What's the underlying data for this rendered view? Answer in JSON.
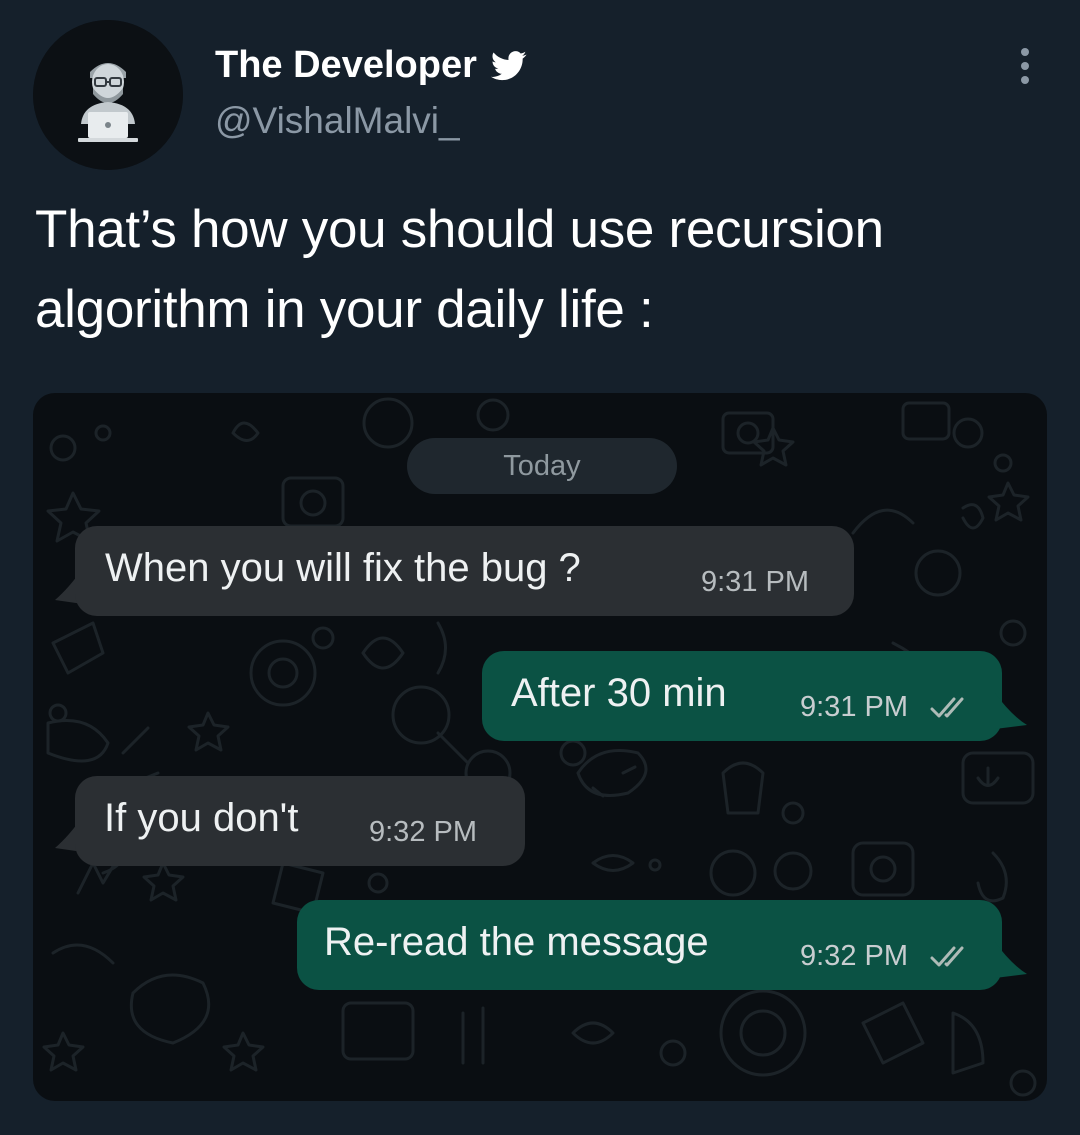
{
  "tweet": {
    "display_name": "The Developer",
    "handle": "@VishalMalvi_",
    "text": "That’s how you should use recursion algorithm in your daily life :",
    "icons": {
      "verified": "twitter-bird-icon",
      "more": "more-vertical-icon",
      "avatar": "developer-avatar-icon"
    }
  },
  "chat": {
    "date_label": "Today",
    "messages": [
      {
        "direction": "incoming",
        "text": "When you will fix the bug ?",
        "time": "9:31 PM"
      },
      {
        "direction": "outgoing",
        "text": "After 30 min",
        "time": "9:31 PM",
        "status": "read"
      },
      {
        "direction": "incoming",
        "text": "If you don't",
        "time": "9:32 PM"
      },
      {
        "direction": "outgoing",
        "text": "Re-read the message",
        "time": "9:32 PM",
        "status": "read"
      }
    ]
  },
  "colors": {
    "background": "#15202b",
    "chat_background": "#0a0e12",
    "incoming_bubble": "#2b2f33",
    "outgoing_bubble": "#0b5244",
    "handle_text": "#8b98a5"
  }
}
